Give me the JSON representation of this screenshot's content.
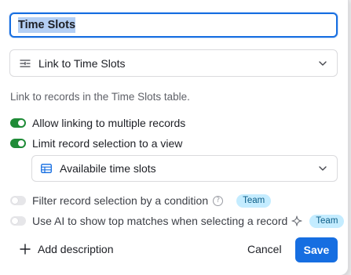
{
  "field_name": {
    "value": "Time Slots"
  },
  "field_type": {
    "label": "Link to Time Slots",
    "icon": "link-field-icon"
  },
  "description_text": "Link to records in the Time Slots table.",
  "options": {
    "allow_multiple": {
      "label": "Allow linking to multiple records",
      "enabled": true
    },
    "limit_to_view": {
      "label": "Limit record selection to a view",
      "enabled": true
    },
    "view_select": {
      "label": "Availabile time slots",
      "icon": "grid-view-icon"
    },
    "filter_condition": {
      "label": "Filter record selection by a condition",
      "enabled": false,
      "help": "?",
      "badge": "Team"
    },
    "ai_matches": {
      "label": "Use AI to show top matches when selecting a record",
      "enabled": false,
      "badge": "Team",
      "icon": "sparkle-icon"
    }
  },
  "footer": {
    "add_description": "Add description",
    "cancel": "Cancel",
    "save": "Save"
  },
  "colors": {
    "accent": "#166ee1",
    "toggle_on": "#1f8b37",
    "badge_bg": "#c4ecff",
    "badge_text": "#0b5c86"
  }
}
